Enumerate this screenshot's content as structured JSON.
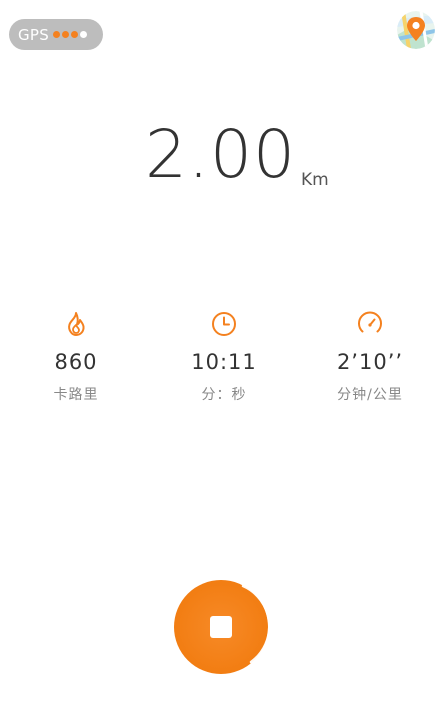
{
  "gps": {
    "label": "GPS",
    "signal_level": 3,
    "signal_max": 4
  },
  "icons": {
    "map": "map-pin-icon",
    "calories": "flame-icon",
    "time": "clock-icon",
    "pace": "speedometer-icon",
    "stop": "stop-icon"
  },
  "distance": {
    "value": "2.00",
    "unit": "Km"
  },
  "stats": [
    {
      "value": "860",
      "label": "卡路里"
    },
    {
      "value": "10:11",
      "label": "分：秒"
    },
    {
      "value": "2’10’’",
      "label": "分钟/公里"
    }
  ],
  "colors": {
    "accent": "#f4811f",
    "text": "#333333",
    "muted": "#888888",
    "pill": "#bdbdbd"
  }
}
